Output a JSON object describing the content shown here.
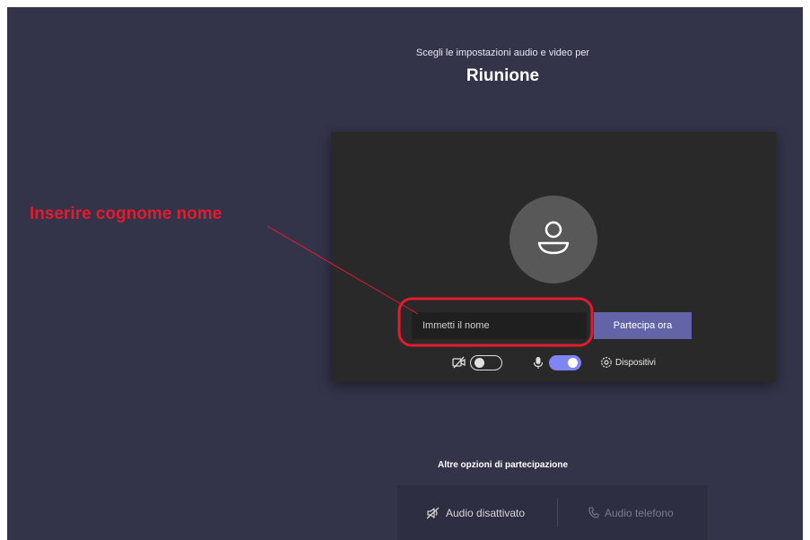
{
  "prejoin": {
    "subtitle": "Scegli le impostazioni audio e video per",
    "title": "Riunione",
    "name_placeholder": "Immetti il nome",
    "join_label": "Partecipa ora",
    "camera_toggle": "off",
    "mic_toggle": "on",
    "devices_label": "Dispositivi"
  },
  "annotation": {
    "text": "Inserire  cognome nome",
    "color": "#e21b2d"
  },
  "other_options": {
    "title": "Altre opzioni di partecipazione",
    "audio_off_label": "Audio disattivato",
    "phone_audio_label": "Audio telefono"
  },
  "colors": {
    "background": "#33344a",
    "panel": "#292929",
    "accent": "#6264a7",
    "toggle_on": "#7f85f5"
  },
  "icons": {
    "avatar": "person-icon",
    "camera": "camera-off-icon",
    "mic": "microphone-icon",
    "devices": "gear-icon",
    "audio_off": "speaker-off-icon",
    "phone": "phone-icon"
  }
}
